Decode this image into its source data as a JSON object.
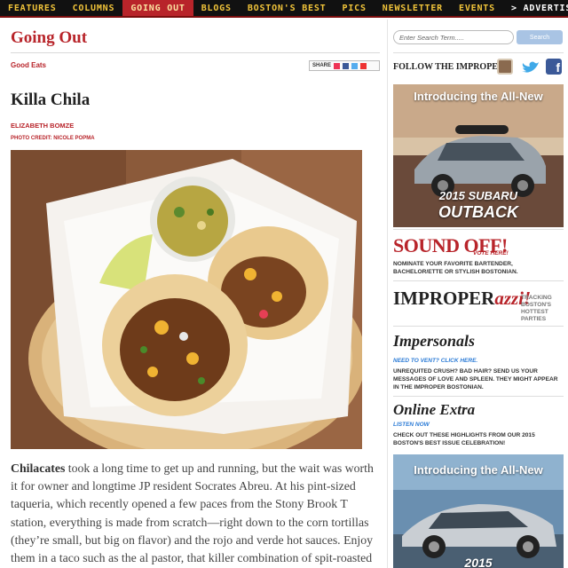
{
  "nav": {
    "items": [
      "FEATURES",
      "COLUMNS",
      "GOING OUT",
      "BLOGS",
      "BOSTON'S BEST",
      "PICS",
      "NEWSLETTER",
      "EVENTS",
      "> ADVERTISING"
    ],
    "active": "GOING OUT"
  },
  "main": {
    "section_title": "Going Out",
    "kicker": "Good Eats",
    "share_label": "SHARE",
    "headline": "Killa Chila",
    "byline": "ELIZABETH BOMZE",
    "photo_credit": "PHOTO CREDIT: NICOLE POPMA",
    "body_lead": "Chilacates",
    "body_text": " took a long time to get up and running, but the wait was worth it for owner and longtime JP resident Socrates Abreu. At his pint-sized taqueria, which recently opened a few paces from the Stony Brook T station, everything is made from scratch—right down to the corn tortillas (they’re small, but big on flavor) and the rojo and verde hot sauces. Enjoy them in a taco such as the al pastor, that killer combination of spit-roasted pork shoulder and"
  },
  "sidebar": {
    "search_placeholder": "Enter Search Term.....",
    "search_button": "Search",
    "follow_label": "FOLLOW THE IMPROPER",
    "social_icons": [
      "instagram-icon",
      "twitter-icon",
      "facebook-icon"
    ],
    "ad1": {
      "title": "Introducing the All-New",
      "model_line1": "2015 SUBARU",
      "model_line2": "OUTBACK"
    },
    "sound_off": {
      "title": "SOUND OFF!",
      "vote": "VOTE HERE!",
      "text": "NOMINATE YOUR FAVORITE BARTENDER, BACHELOR/ETTE OR STYLISH BOSTONIAN."
    },
    "improperazzi": {
      "title_a": "IMPROPER",
      "title_b": "azzi!",
      "tracking": "TRACKING BOSTON'S HOTTEST PARTIES"
    },
    "impersonals": {
      "title": "Impersonals",
      "sub": "NEED TO VENT? CLICK HERE.",
      "text": "UNREQUITED CRUSH? BAD HAIR? SEND US YOUR MESSAGES OF LOVE AND SPLEEN. THEY MIGHT APPEAR IN THE IMPROPER BOSTONIAN."
    },
    "online_extra": {
      "title": "Online Extra",
      "sub": "LISTEN NOW",
      "text": "CHECK OUT THESE HIGHLIGHTS FROM OUR 2015 BOSTON'S BEST ISSUE CELEBRATION!"
    },
    "ad2": {
      "title": "Introducing the All-New",
      "model_line1": "2015"
    }
  },
  "colors": {
    "accent_red": "#b8242a",
    "nav_bg": "#111111",
    "nav_text": "#f1c43a",
    "link_blue": "#2b7bd6"
  }
}
